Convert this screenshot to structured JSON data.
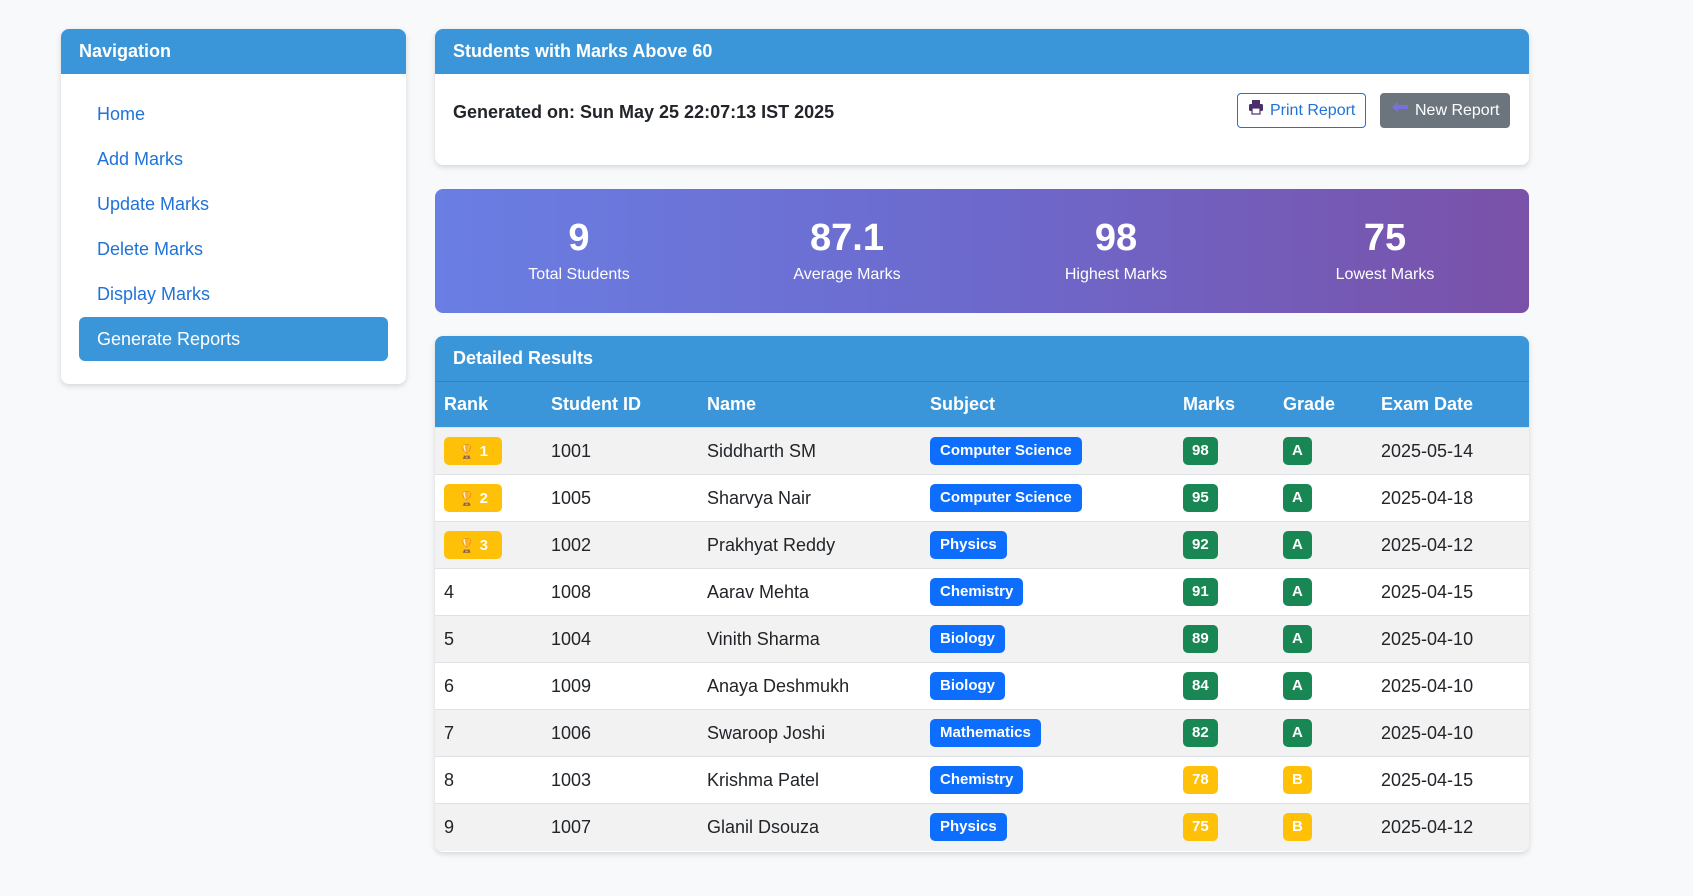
{
  "nav": {
    "title": "Navigation",
    "items": [
      {
        "label": "Home",
        "active": false
      },
      {
        "label": "Add Marks",
        "active": false
      },
      {
        "label": "Update Marks",
        "active": false
      },
      {
        "label": "Delete Marks",
        "active": false
      },
      {
        "label": "Display Marks",
        "active": false
      },
      {
        "label": "Generate Reports",
        "active": true
      }
    ]
  },
  "report": {
    "title": "Students with Marks Above 60",
    "generated": "Generated on: Sun May 25 22:07:13 IST 2025",
    "print_label": "Print Report",
    "new_label": "New Report"
  },
  "stats": [
    {
      "value": "9",
      "label": "Total Students"
    },
    {
      "value": "87.1",
      "label": "Average Marks"
    },
    {
      "value": "98",
      "label": "Highest Marks"
    },
    {
      "value": "75",
      "label": "Lowest Marks"
    }
  ],
  "results": {
    "title": "Detailed Results",
    "columns": [
      "Rank",
      "Student ID",
      "Name",
      "Subject",
      "Marks",
      "Grade",
      "Exam Date"
    ],
    "rows": [
      {
        "rank": "1",
        "top": true,
        "id": "1001",
        "name": "Siddharth SM",
        "subject": "Computer Science",
        "marks": "98",
        "grade": "A",
        "date": "2025-05-14"
      },
      {
        "rank": "2",
        "top": true,
        "id": "1005",
        "name": "Sharvya Nair",
        "subject": "Computer Science",
        "marks": "95",
        "grade": "A",
        "date": "2025-04-18"
      },
      {
        "rank": "3",
        "top": true,
        "id": "1002",
        "name": "Prakhyat Reddy",
        "subject": "Physics",
        "marks": "92",
        "grade": "A",
        "date": "2025-04-12"
      },
      {
        "rank": "4",
        "top": false,
        "id": "1008",
        "name": "Aarav Mehta",
        "subject": "Chemistry",
        "marks": "91",
        "grade": "A",
        "date": "2025-04-15"
      },
      {
        "rank": "5",
        "top": false,
        "id": "1004",
        "name": "Vinith Sharma",
        "subject": "Biology",
        "marks": "89",
        "grade": "A",
        "date": "2025-04-10"
      },
      {
        "rank": "6",
        "top": false,
        "id": "1009",
        "name": "Anaya Deshmukh",
        "subject": "Biology",
        "marks": "84",
        "grade": "A",
        "date": "2025-04-10"
      },
      {
        "rank": "7",
        "top": false,
        "id": "1006",
        "name": "Swaroop Joshi",
        "subject": "Mathematics",
        "marks": "82",
        "grade": "A",
        "date": "2025-04-10"
      },
      {
        "rank": "8",
        "top": false,
        "id": "1003",
        "name": "Krishma Patel",
        "subject": "Chemistry",
        "marks": "78",
        "grade": "B",
        "date": "2025-04-15"
      },
      {
        "rank": "9",
        "top": false,
        "id": "1007",
        "name": "Glanil Dsouza",
        "subject": "Physics",
        "marks": "75",
        "grade": "B",
        "date": "2025-04-12"
      }
    ]
  },
  "colors": {
    "header_blue": "#3a96d9",
    "link_blue": "#1f73d6",
    "subject_blue": "#0d6efd",
    "grade_a_green": "#198754",
    "grade_b_yellow": "#ffc107",
    "gray_button": "#6c757d"
  },
  "icons": {
    "print": "printer-icon",
    "new": "back-arrow-icon",
    "rank_top": "trophy-icon"
  }
}
